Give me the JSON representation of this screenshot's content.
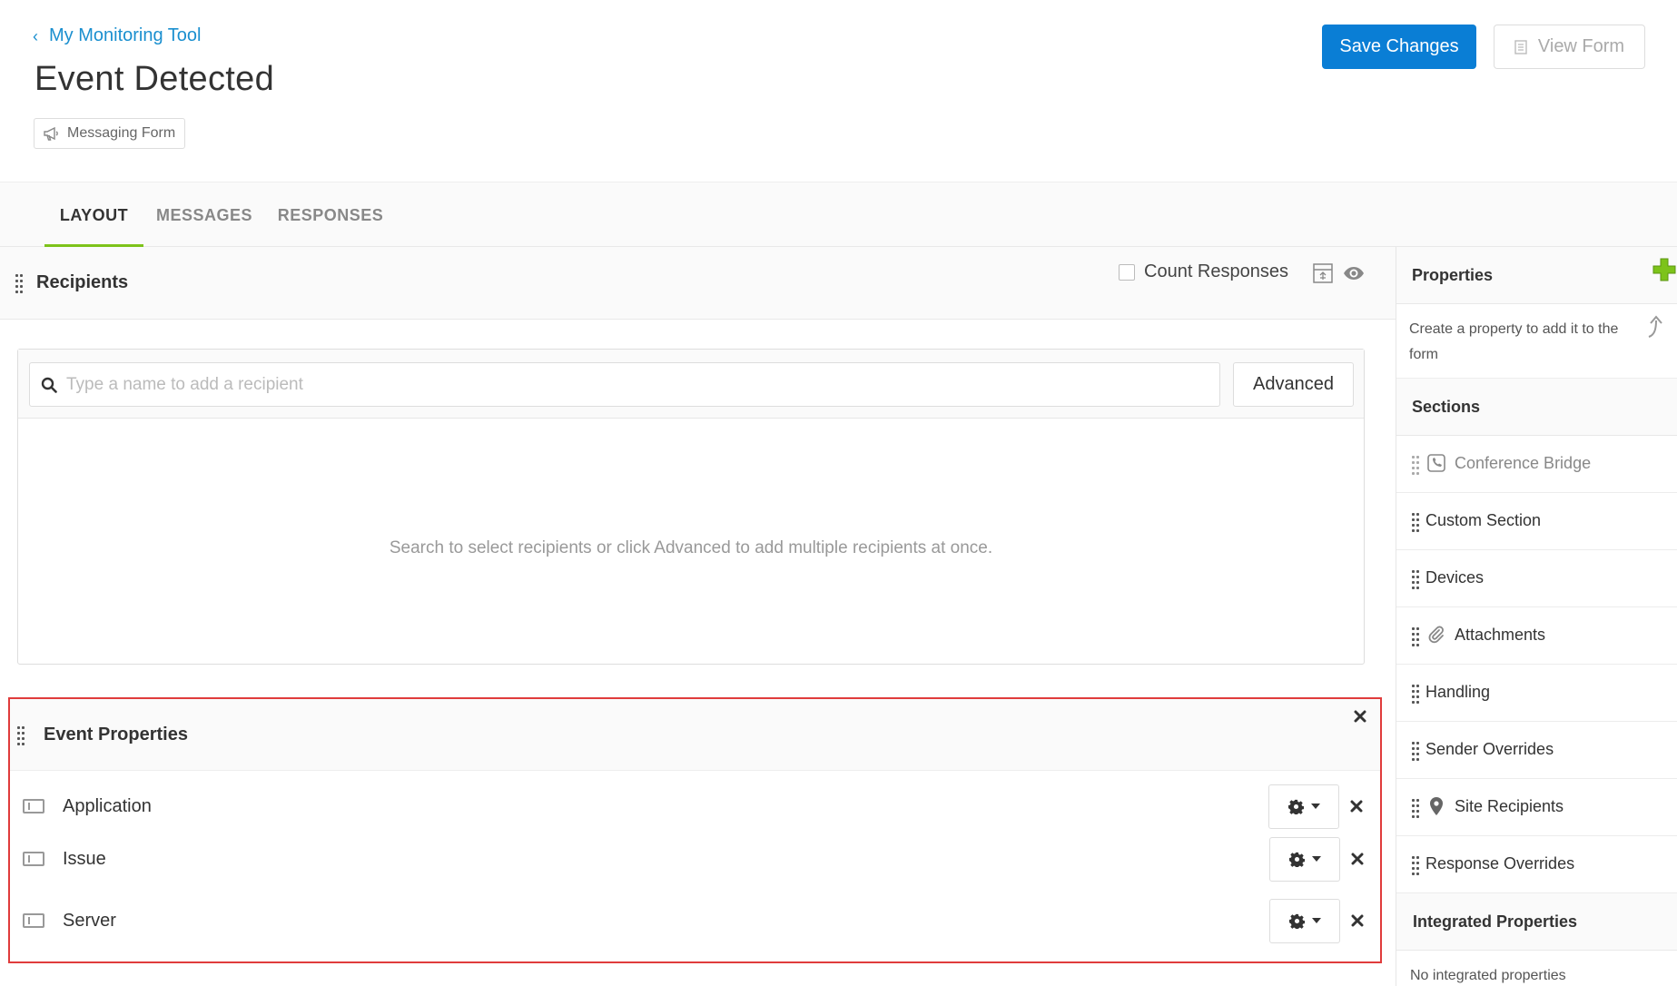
{
  "header": {
    "breadcrumb": "My Monitoring Tool",
    "title": "Event Detected",
    "form_type": "Messaging Form",
    "save_label": "Save Changes",
    "view_label": "View Form",
    "colors": {
      "primary": "#0a7ed5",
      "link": "#1a8fcf",
      "accent": "#7dc31a",
      "highlight": "#e03c3c"
    }
  },
  "tabs": [
    {
      "label": "LAYOUT",
      "active": true
    },
    {
      "label": "MESSAGES",
      "active": false
    },
    {
      "label": "RESPONSES",
      "active": false
    }
  ],
  "recipients": {
    "title": "Recipients",
    "count_responses_label": "Count Responses",
    "count_responses_checked": false,
    "search_placeholder": "Type a name to add a recipient",
    "advanced_label": "Advanced",
    "empty_text": "Search to select recipients or click Advanced to add multiple recipients at once."
  },
  "event_properties": {
    "title": "Event Properties",
    "rows": [
      {
        "label": "Application"
      },
      {
        "label": "Issue"
      },
      {
        "label": "Server"
      }
    ]
  },
  "sidebar": {
    "properties_title": "Properties",
    "properties_desc": "Create a property to add it to the form",
    "sections_title": "Sections",
    "sections": [
      {
        "label": "Conference Bridge",
        "icon": "phone-icon",
        "disabled": true
      },
      {
        "label": "Custom Section",
        "icon": "",
        "disabled": false
      },
      {
        "label": "Devices",
        "icon": "",
        "disabled": false
      },
      {
        "label": "Attachments",
        "icon": "paperclip-icon",
        "disabled": false
      },
      {
        "label": "Handling",
        "icon": "",
        "disabled": false
      },
      {
        "label": "Sender Overrides",
        "icon": "",
        "disabled": false
      },
      {
        "label": "Site Recipients",
        "icon": "map-pin-icon",
        "disabled": false
      },
      {
        "label": "Response Overrides",
        "icon": "",
        "disabled": false
      }
    ],
    "integrated_title": "Integrated Properties",
    "integrated_empty": "No integrated properties"
  }
}
